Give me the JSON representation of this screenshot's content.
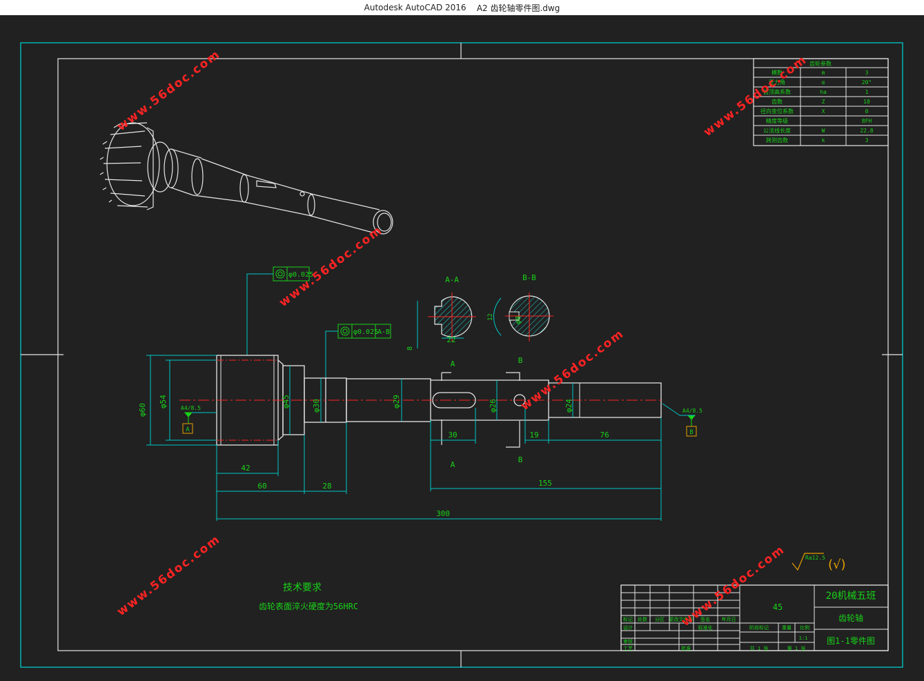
{
  "window": {
    "app": "Autodesk AutoCAD 2016",
    "file": "A2 齿轮轴零件图.dwg"
  },
  "watermark": "www.56doc.com",
  "colors": {
    "background": "#212121",
    "frame": "#00c8c8",
    "outline": "#e8e8e8",
    "text": "#19d219",
    "dimension": "#00c8c8",
    "centerline": "#ff2323",
    "watermark": "#ff2323"
  },
  "gear_table": {
    "title": "齿轮参数",
    "rows": [
      {
        "name": "模数",
        "symbol": "m",
        "value": "3"
      },
      {
        "name": "压力角",
        "symbol": "α",
        "value": "20°"
      },
      {
        "name": "齿顶高系数",
        "symbol": "ha",
        "value": "1"
      },
      {
        "name": "齿数",
        "symbol": "Z",
        "value": "18"
      },
      {
        "name": "径向变位系数",
        "symbol": "X",
        "value": "0"
      },
      {
        "name": "精度等级",
        "symbol": "",
        "value": "8FH"
      },
      {
        "name": "公法线长度",
        "symbol": "W",
        "value": "22.8"
      },
      {
        "name": "跨测齿数",
        "symbol": "k",
        "value": "3"
      }
    ]
  },
  "sections": {
    "aa": "A-A",
    "bb": "B-B",
    "aa_width": "22",
    "aa_depth": "8",
    "bb_dia": "φ8",
    "bb_offset": "12"
  },
  "tolerance": {
    "frame1": "φ0.025",
    "frame2": "φ0.025",
    "frame2_ref": "A-B"
  },
  "roughness": {
    "label1": "A4/8.5",
    "label2": "A4/8.5",
    "datum1": "A",
    "datum2": "B",
    "symbol": "Ra12.5"
  },
  "cut_marks": {
    "a": "A",
    "b": "B"
  },
  "diameters": {
    "d60": "φ60",
    "d54": "φ54",
    "d45": "φ45",
    "d30": "φ30",
    "d29": "φ29",
    "d26": "φ26",
    "d24": "φ24"
  },
  "dims": {
    "l42": "42",
    "l60": "60",
    "l28": "28",
    "l30": "30",
    "l19": "19",
    "l76": "76",
    "l155": "155",
    "l300": "300"
  },
  "requirements": {
    "title": "技术要求",
    "text": "齿轮表面淬火硬度为56HRC"
  },
  "title_block": {
    "material": "45",
    "school": "20机械五班",
    "part_name": "齿轮轴",
    "drawing_no": "图1-1零件图",
    "scale": "1:1",
    "sheet": "第 1 张",
    "sheets": "共 1 张",
    "labels": {
      "design": "设计",
      "check": "审核",
      "process": "工艺",
      "mark": "标记",
      "count": "处数",
      "zone": "分区",
      "doc": "更改文件号",
      "sign": "签名",
      "date": "年月日",
      "std": "标准化",
      "approve": "批准",
      "stage": "阶段标记",
      "weight": "重量",
      "ratio": "比例"
    }
  }
}
